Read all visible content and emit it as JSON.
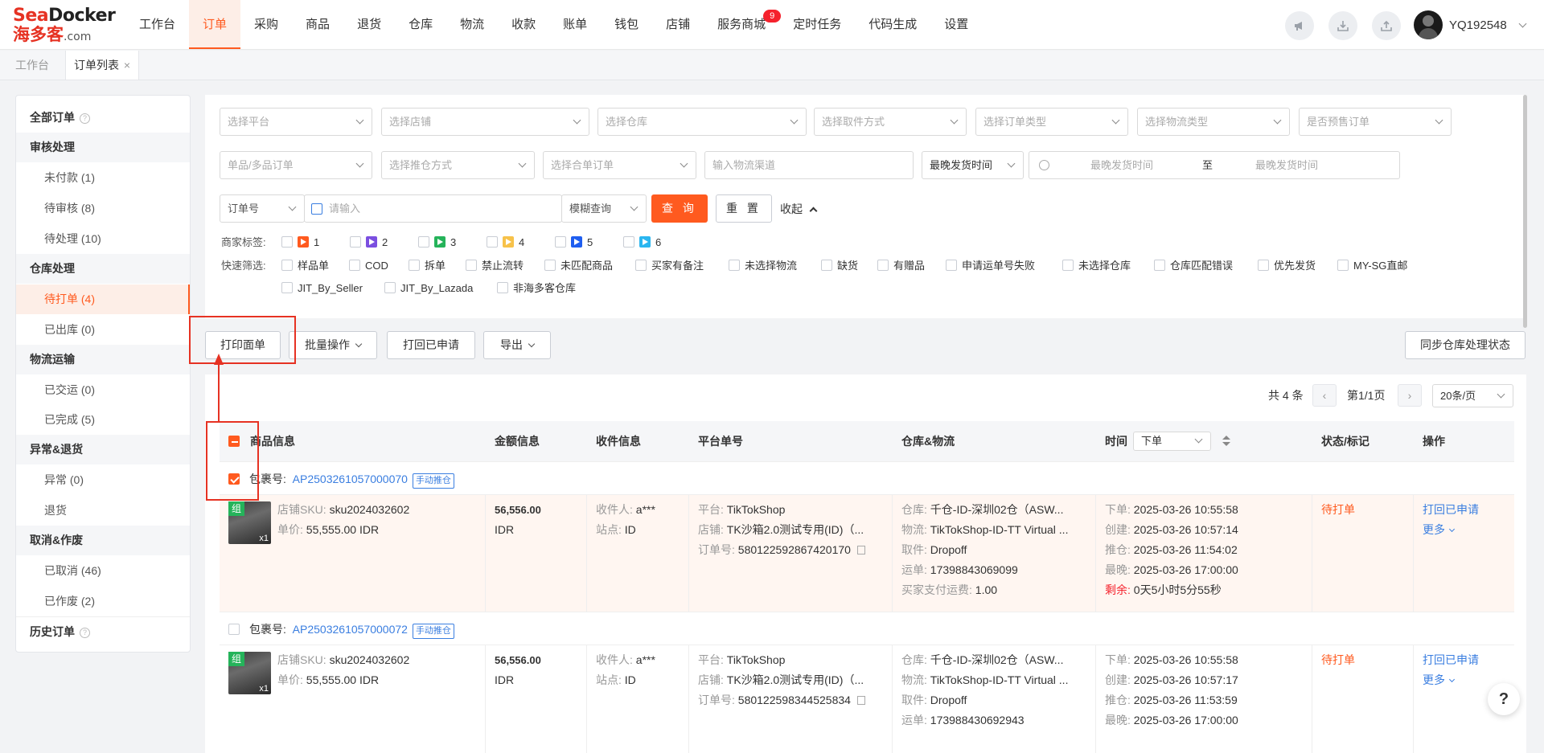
{
  "brand": {
    "name_en": "SeaDocker",
    "name_cn": "海多客",
    "domain_suffix": ".com"
  },
  "nav": {
    "items": [
      "工作台",
      "订单",
      "采购",
      "商品",
      "退货",
      "仓库",
      "物流",
      "收款",
      "账单",
      "钱包",
      "店铺",
      "服务商城",
      "定时任务",
      "代码生成",
      "设置"
    ],
    "active": "订单",
    "badge": "9"
  },
  "user": {
    "name": "YQ192548"
  },
  "tabs": {
    "home": "工作台",
    "orders": "订单列表",
    "close": "×"
  },
  "sidebar": {
    "all": "全部订单",
    "review_head": "审核处理",
    "unpaid": "未付款 (1)",
    "pending_review": "待审核 (8)",
    "pending_process": "待处理 (10)",
    "warehouse_head": "仓库处理",
    "to_print": "待打单 (4)",
    "shipped_out": "已出库 (0)",
    "logistics_head": "物流运输",
    "delivered": "已交运 (0)",
    "completed": "已完成 (5)",
    "exception_head": "异常&退货",
    "exception": "异常 (0)",
    "returns": "退货",
    "cancel_head": "取消&作废",
    "cancelled": "已取消 (46)",
    "voided": "已作废 (2)",
    "history": "历史订单"
  },
  "filters": {
    "platform": "选择平台",
    "store": "选择店铺",
    "warehouse": "选择仓库",
    "pickup": "选择取件方式",
    "order_type": "选择订单类型",
    "logistics_type": "选择物流类型",
    "presale": "是否预售订单",
    "item_count": "单品/多品订单",
    "push_method": "选择推仓方式",
    "merge": "选择合单订单",
    "channel": "输入物流渠道",
    "ship_time": "最晚发货时间",
    "date_start": "最晚发货时间",
    "date_sep": "至",
    "date_end": "最晚发货时间",
    "order_no": "订单号",
    "keyword": "请输入",
    "match": "模糊查询",
    "search": "查 询",
    "reset": "重 置",
    "collapse": "收起"
  },
  "merchant_tags": {
    "label": "商家标签:",
    "items": [
      "1",
      "2",
      "3",
      "4",
      "5",
      "6"
    ],
    "colors": [
      "#ff5a1f",
      "#7b4fe0",
      "#25b35a",
      "#f7c24a",
      "#1f5ef0",
      "#2ab6f0"
    ]
  },
  "quick_filter": {
    "label": "快速筛选:",
    "items": [
      "样品单",
      "COD",
      "拆单",
      "禁止流转",
      "未匹配商品",
      "买家有备注",
      "未选择物流",
      "缺货",
      "有赠品",
      "申请运单号失败",
      "未选择仓库",
      "仓库匹配错误",
      "优先发货",
      "MY-SG直邮",
      "JIT_By_Seller",
      "JIT_By_Lazada",
      "非海多客仓库"
    ]
  },
  "actions": {
    "print": "打印面单",
    "batch": "批量操作",
    "print_applied": "打回已申请",
    "export": "导出",
    "sync": "同步仓库处理状态"
  },
  "pagination": {
    "total": "共 4 条",
    "page": "第1/1页",
    "page_size": "20条/页"
  },
  "table": {
    "headers": {
      "product": "商品信息",
      "amount": "金额信息",
      "receiver": "收件信息",
      "platform": "平台单号",
      "warehouse": "仓库&物流",
      "time": "时间",
      "time_sort": "下单",
      "status": "状态/标记",
      "ops": "操作"
    },
    "package_label": "包裹号:",
    "push_tag": "手动推仓",
    "orders": [
      {
        "package_no": "AP2503261057000070",
        "sku_label": "店铺SKU:",
        "sku": "sku2024032602",
        "price_label": "单价:",
        "price": "55,555.00 IDR",
        "qty": "x1",
        "group": "组",
        "amount": "56,556.00",
        "currency": "IDR",
        "receiver_label": "收件人:",
        "receiver": "a***",
        "site_label": "站点:",
        "site": "ID",
        "platform_label": "平台:",
        "platform": "TikTokShop",
        "store_label": "店铺:",
        "store": "TK沙箱2.0测试专用(ID)（...",
        "order_label": "订单号:",
        "order_no": "580122592867420170",
        "wh_label": "仓库:",
        "wh": "千仓-ID-深圳02仓（ASW...",
        "logi_label": "物流:",
        "logi": "TikTokShop-ID-TT Virtual ...",
        "pick_label": "取件:",
        "pick": "Dropoff",
        "waybill_label": "运单:",
        "waybill": "17398843069099",
        "fee_label": "买家支付运费:",
        "fee": "1.00",
        "t_order_label": "下单:",
        "t_order": "2025-03-26 10:55:58",
        "t_create_label": "创建:",
        "t_create": "2025-03-26 10:57:14",
        "t_push_label": "推仓:",
        "t_push": "2025-03-26 11:54:02",
        "t_latest_label": "最晚:",
        "t_latest": "2025-03-26 17:00:00",
        "t_remain_label": "剩余:",
        "t_remain": "0天5小时5分55秒",
        "status": "待打单",
        "op1": "打回已申请",
        "op2": "更多"
      },
      {
        "package_no": "AP2503261057000072",
        "sku_label": "店铺SKU:",
        "sku": "sku2024032602",
        "price_label": "单价:",
        "price": "55,555.00 IDR",
        "qty": "x1",
        "group": "组",
        "amount": "56,556.00",
        "currency": "IDR",
        "receiver_label": "收件人:",
        "receiver": "a***",
        "site_label": "站点:",
        "site": "ID",
        "platform_label": "平台:",
        "platform": "TikTokShop",
        "store_label": "店铺:",
        "store": "TK沙箱2.0测试专用(ID)（...",
        "order_label": "订单号:",
        "order_no": "580122598344525834",
        "wh_label": "仓库:",
        "wh": "千仓-ID-深圳02仓（ASW...",
        "logi_label": "物流:",
        "logi": "TikTokShop-ID-TT Virtual ...",
        "pick_label": "取件:",
        "pick": "Dropoff",
        "waybill_label": "运单:",
        "waybill": "173988430692943",
        "t_order_label": "下单:",
        "t_order": "2025-03-26 10:55:58",
        "t_create_label": "创建:",
        "t_create": "2025-03-26 10:57:17",
        "t_push_label": "推仓:",
        "t_push": "2025-03-26 11:53:59",
        "t_latest_label": "最晚:",
        "t_latest": "2025-03-26 17:00:00",
        "status": "待打单",
        "op1": "打回已申请",
        "op2": "更多"
      }
    ]
  },
  "help": "?"
}
